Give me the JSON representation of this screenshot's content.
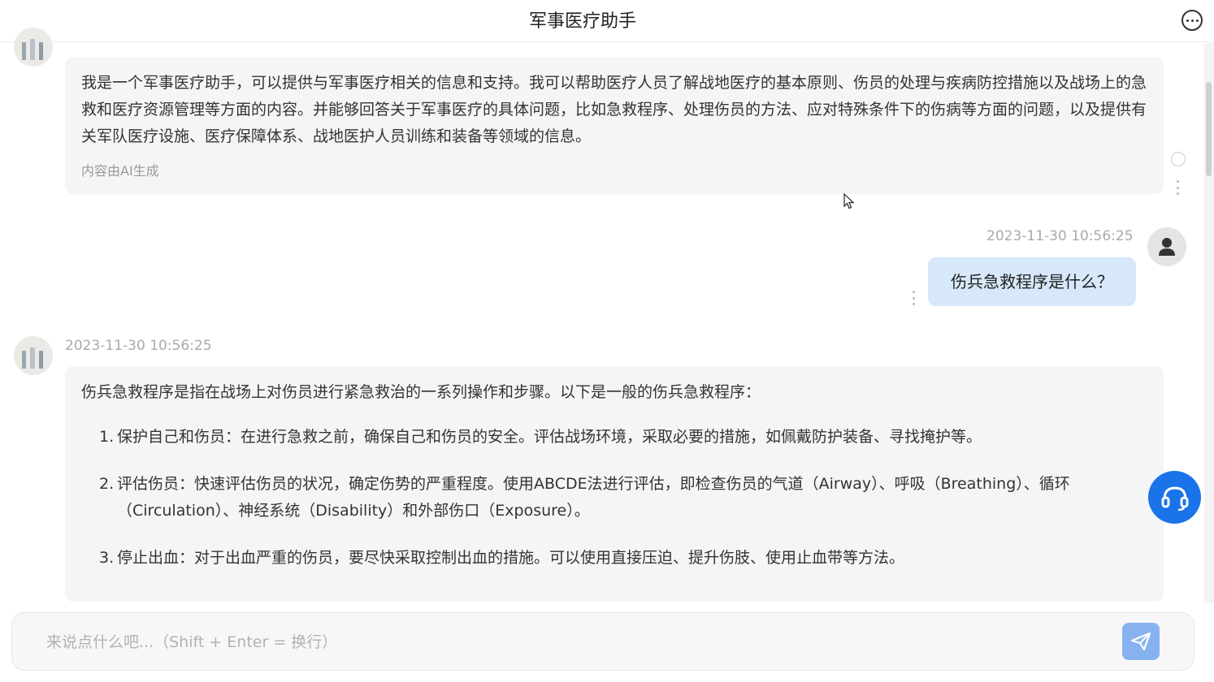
{
  "header": {
    "title": "军事医疗助手",
    "more_icon": "more-horizontal-icon"
  },
  "messages": [
    {
      "role": "ai",
      "text": "我是一个军事医疗助手，可以提供与军事医疗相关的信息和支持。我可以帮助医疗人员了解战地医疗的基本原则、伤员的处理与疾病防控措施以及战场上的急救和医疗资源管理等方面的内容。并能够回答关于军事医疗的具体问题，比如急救程序、处理伤员的方法、应对特殊条件下的伤病等方面的问题，以及提供有关军队医疗设施、医疗保障体系、战地医护人员训练和装备等领域的信息。",
      "note": "内容由AI生成"
    },
    {
      "role": "user",
      "timestamp": "2023-11-30 10:56:25",
      "text": "伤兵急救程序是什么？"
    },
    {
      "role": "ai",
      "timestamp": "2023-11-30 10:56:25",
      "intro": "伤兵急救程序是指在战场上对伤员进行紧急救治的一系列操作和步骤。以下是一般的伤兵急救程序：",
      "steps": [
        {
          "num": "1.",
          "text": "保护自己和伤员：在进行急救之前，确保自己和伤员的安全。评估战场环境，采取必要的措施，如佩戴防护装备、寻找掩护等。"
        },
        {
          "num": "2.",
          "text": "评估伤员：快速评估伤员的状况，确定伤势的严重程度。使用ABCDE法进行评估，即检查伤员的气道（Airway）、呼吸（Breathing）、循环（Circulation）、神经系统（Disability）和外部伤口（Exposure）。"
        },
        {
          "num": "3.",
          "text": "停止出血：对于出血严重的伤员，要尽快采取控制出血的措施。可以使用直接压迫、提升伤肢、使用止血带等方法。"
        }
      ]
    }
  ],
  "composer": {
    "placeholder": "来说点什么吧...（Shift + Enter = 换行）",
    "value": "",
    "send_icon": "send-icon"
  },
  "floating": {
    "headset_icon": "headset-icon"
  },
  "colors": {
    "accent": "#1a73e8",
    "send_button": "#88b2ef",
    "user_bubble": "#d6e8f9",
    "ai_bubble": "#f4f5f6"
  }
}
